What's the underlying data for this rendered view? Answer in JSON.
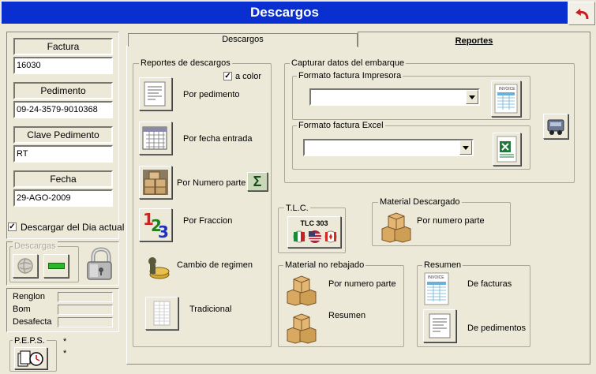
{
  "window": {
    "title": "Descargos"
  },
  "sidebar": {
    "factura_label": "Factura",
    "factura_value": "16030",
    "pedimento_label": "Pedimento",
    "pedimento_value": "09-24-3579-9010368",
    "clave_label": "Clave Pedimento",
    "clave_value": "RT",
    "fecha_label": "Fecha",
    "fecha_value": "29-AGO-2009",
    "descargar_label": "Descargar del Dia actual",
    "descargar_checked": true,
    "descargas_group": "Descargas",
    "renglon_label": "Renglon",
    "bom_label": "Bom",
    "desafecta_label": "Desafecta",
    "peps_group": "P.E.P.S.",
    "star": "*"
  },
  "tabs": [
    {
      "label": "Descargos",
      "active": false
    },
    {
      "label": "Reportes",
      "active": true
    }
  ],
  "reportes_descargos": {
    "title": "Reportes de descargos",
    "a_color_label": "a color",
    "a_color_checked": true,
    "items": [
      {
        "label": "Por pedimento",
        "icon": "report-document-icon"
      },
      {
        "label": "Por fecha entrada",
        "icon": "calendar-icon"
      },
      {
        "label": "Por Numero parte",
        "icon": "boxes-warehouse-icon"
      },
      {
        "label": "Por Fraccion",
        "icon": "numbers-123-icon"
      },
      {
        "label": "Cambio de regimen",
        "icon": "coins-icon"
      },
      {
        "label": "Tradicional",
        "icon": "spreadsheet-icon"
      }
    ],
    "sum_icon": "sigma-icon"
  },
  "embarque": {
    "title": "Capturar datos del embarque",
    "impresora_title": "Formato factura Impresora",
    "impresora_value": "",
    "excel_title": "Formato factura Excel",
    "excel_value": "",
    "invoice_icon_text": "INVOICE"
  },
  "tlc": {
    "title": "T.L.C.",
    "button_label": "TLC 303"
  },
  "material_descargado": {
    "title": "Material Descargado",
    "item_label": "Por numero parte"
  },
  "material_no_rebajado": {
    "title": "Material no rebajado",
    "items": [
      "Por numero parte",
      "Resumen"
    ]
  },
  "resumen": {
    "title": "Resumen",
    "items": [
      "De facturas",
      "De pedimentos"
    ]
  },
  "colors": {
    "title_bar": "#0a2fd0",
    "window_bg": "#ece9d8"
  }
}
